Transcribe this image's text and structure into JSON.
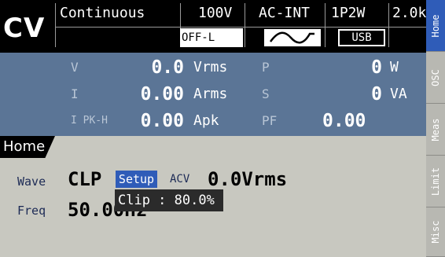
{
  "status": {
    "mode": "CV",
    "function": "Continuous",
    "voltage_range": "100V",
    "signal_source": "AC-INT",
    "phase_wire": "1P2W",
    "frequency_range": "2.0k",
    "output_state": "OFF-L",
    "waveform_icon": "sine-wave-icon",
    "interface": "USB"
  },
  "measurements": {
    "v_label": "V",
    "v_value": "0.0",
    "v_unit": "Vrms",
    "i_label": "I",
    "i_value": "0.00",
    "i_unit": "Arms",
    "ipk_label": "I PK-H",
    "ipk_value": "0.00",
    "ipk_unit": "Apk",
    "p_label": "P",
    "p_value": "0",
    "p_unit": "W",
    "s_label": "S",
    "s_value": "0",
    "s_unit": "VA",
    "pf_label": "PF",
    "pf_value": "0.00"
  },
  "home": {
    "title": "Home",
    "wave_label": "Wave",
    "wave_value": "CLP",
    "setup_label": "Setup",
    "acv_label": "ACV",
    "acv_value": "0.0Vrms",
    "freq_label": "Freq",
    "freq_value": "50.00Hz",
    "popup_text": "Clip : 80.0%"
  },
  "side_tabs": [
    "Home",
    "OSC",
    "Meas",
    "Limit",
    "Misc"
  ],
  "colors": {
    "panel": "#5b7596",
    "content_bg": "#c8c8c0",
    "active_tab": "#2f5cb8",
    "popup_bg": "#2b2b2b"
  }
}
